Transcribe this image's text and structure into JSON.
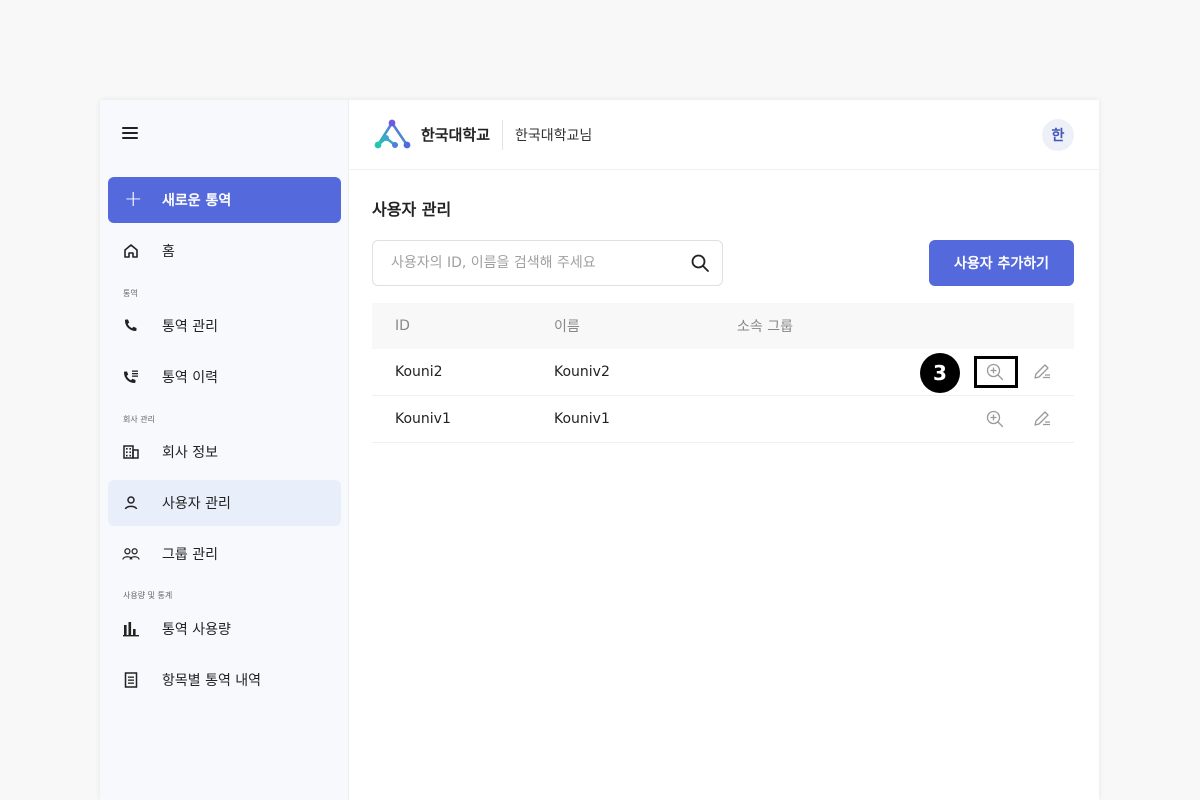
{
  "sidebar": {
    "new_call_label": "새로운 통역",
    "home_label": "홈",
    "section_call": "통역",
    "call_manage_label": "통역 관리",
    "call_history_label": "통역 이력",
    "section_company": "회사 관리",
    "company_info_label": "회사 정보",
    "user_manage_label": "사용자 관리",
    "group_manage_label": "그룹 관리",
    "section_stats": "사용량 및 통계",
    "usage_label": "통역 사용량",
    "itemized_label": "항목별 통역 내역"
  },
  "header": {
    "org_name": "한국대학교",
    "user_name": "한국대학교님",
    "avatar_initial": "한"
  },
  "main": {
    "title": "사용자 관리",
    "search_placeholder": "사용자의 ID, 이름을 검색해 주세요",
    "add_button": "사용자 추가하기",
    "columns": {
      "id": "ID",
      "name": "이름",
      "group": "소속 그룹"
    },
    "rows": [
      {
        "id": "Kouni2",
        "name": "Kouniv2",
        "group": ""
      },
      {
        "id": "Kouniv1",
        "name": "Kouniv1",
        "group": ""
      }
    ]
  },
  "annotation": {
    "step": "3"
  },
  "colors": {
    "accent": "#5469dc",
    "active_bg": "#e9eefb",
    "sidebar_bg": "#f7f9fd"
  }
}
